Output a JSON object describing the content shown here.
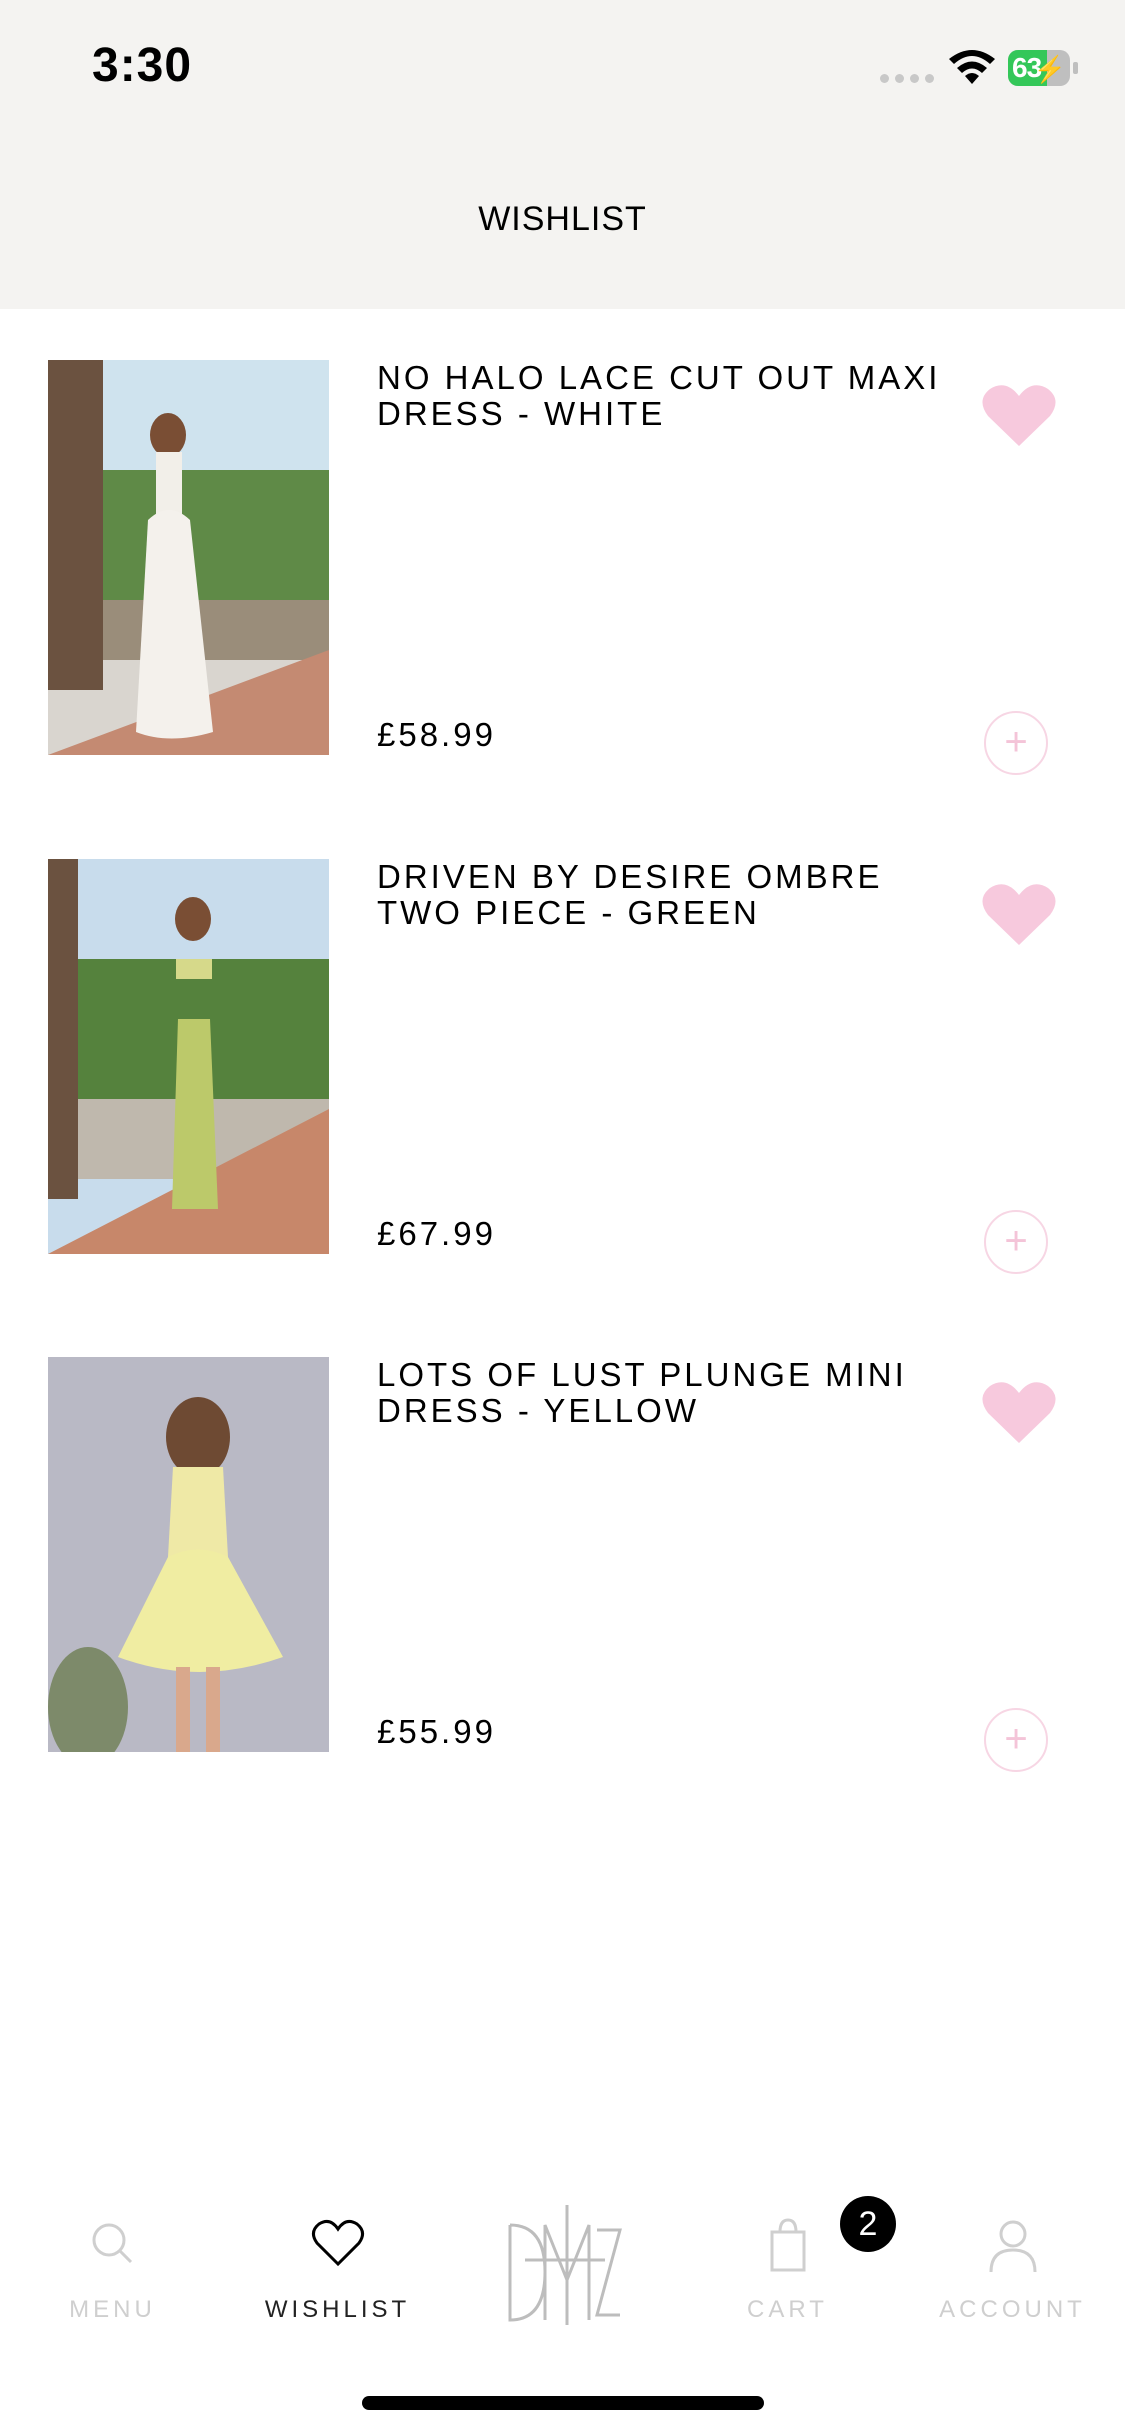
{
  "status": {
    "time": "3:30",
    "battery": "63"
  },
  "header": {
    "title": "WISHLIST"
  },
  "items": [
    {
      "name": "NO HALO LACE CUT OUT MAXI DRESS - WHITE",
      "price": "£58.99"
    },
    {
      "name": "DRIVEN BY DESIRE OMBRE TWO PIECE - GREEN",
      "price": "£67.99"
    },
    {
      "name": "LOTS OF LUST PLUNGE MINI DRESS - YELLOW",
      "price": "£55.99"
    }
  ],
  "tabbar": {
    "menu": "MENU",
    "wishlist": "WISHLIST",
    "cart": "CART",
    "cart_count": "2",
    "account": "ACCOUNT"
  },
  "colors": {
    "accent_pink": "#f7c9dd",
    "header_bg": "#f4f3f1",
    "battery_green": "#34c759"
  }
}
